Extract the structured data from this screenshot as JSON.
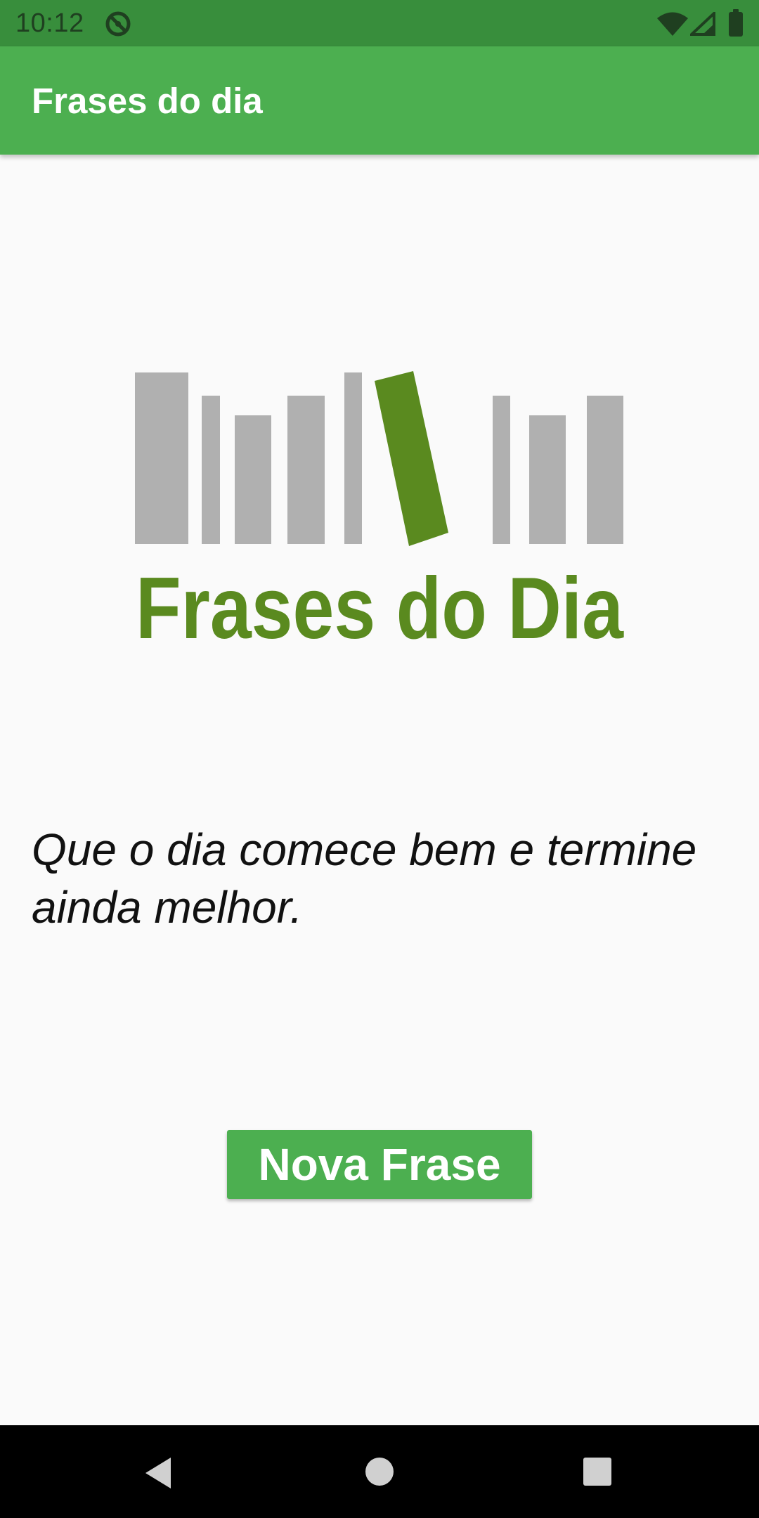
{
  "status_bar": {
    "time": "10:12",
    "icons": [
      "sync-icon",
      "wifi-icon",
      "cellular-signal-icon",
      "battery-icon"
    ]
  },
  "app_bar": {
    "title": "Frases do dia",
    "background_color": "#4caf50"
  },
  "logo": {
    "text": "Frases do Dia",
    "brand_color": "#5a8a1f",
    "bar_color": "#b0b0b0"
  },
  "quote": {
    "text": "Que o dia comece bem e termine ainda melhor."
  },
  "actions": {
    "new_phrase_label": "Nova Frase"
  },
  "navigation_bar": {
    "icons": [
      "back-icon",
      "home-icon",
      "recents-icon"
    ]
  }
}
